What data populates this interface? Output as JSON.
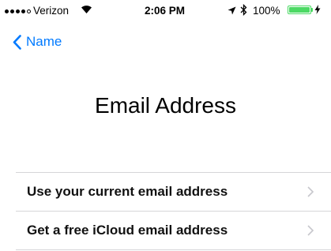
{
  "status_bar": {
    "carrier": "Verizon",
    "time": "2:06 PM",
    "battery_percent": "100%",
    "signal_bars_filled": 4,
    "signal_bars_total": 5
  },
  "nav": {
    "back_label": "Name"
  },
  "page": {
    "title": "Email Address"
  },
  "options": [
    {
      "label": "Use your current email address",
      "icon": "chevron-right-icon"
    },
    {
      "label": "Get a free iCloud email address",
      "icon": "chevron-right-icon"
    }
  ],
  "colors": {
    "accent": "#007aff",
    "battery": "#4cd964",
    "chevron": "#c7c7cc",
    "divider": "#d5d5d8"
  }
}
